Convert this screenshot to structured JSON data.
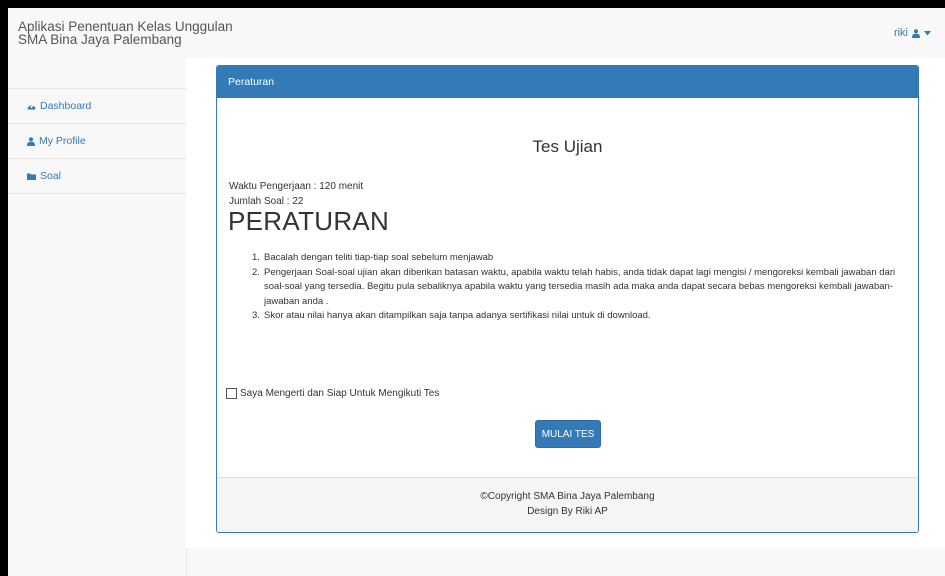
{
  "navbar": {
    "brand_line1": "Aplikasi Penentuan Kelas Unggulan",
    "brand_line2": "SMA Bina Jaya Palembang",
    "user_name": "riki",
    "user_icon": "user-icon",
    "caret_icon": "caret-down-icon"
  },
  "sidebar": {
    "items": [
      {
        "label": "Dashboard",
        "icon": "dashboard-icon"
      },
      {
        "label": "My Profile",
        "icon": "user-icon"
      },
      {
        "label": "Soal",
        "icon": "folder-icon"
      }
    ]
  },
  "panel": {
    "heading": "Peraturan",
    "test_title": "Tes Ujian",
    "duration": "Waktu Pengerjaan : 120 menit",
    "question_count": "Jumlah Soal : 22",
    "rules_title": "PERATURAN",
    "rules": [
      {
        "num": "1.",
        "text": "Bacalah dengan teliti tiap-tiap soal sebelum menjawab"
      },
      {
        "num": "2.",
        "text": "Pengerjaan Soal-soal ujian akan diberikan batasan waktu, apabila waktu telah habis, anda tidak dapat lagi mengisi / mengoreksi kembali jawaban dari soal-soal yang tersedia. Begitu pula sebaliknya apabila waktu yang tersedia masih ada maka anda dapat secara bebas mengoreksi kembali jawaban-jawaban anda ."
      },
      {
        "num": "3.",
        "text": "Skor atau nilai hanya akan ditampilkan saja tanpa adanya sertifikasi nilai untuk di download."
      }
    ],
    "agree_label": "Saya Mengerti dan Siap Untuk Mengikuti Tes",
    "agree_checked": false,
    "start_button": "MULAI TES",
    "footer_line1": "©Copyright SMA Bina Jaya Palembang",
    "footer_line2": "Design By Riki AP"
  },
  "colors": {
    "primary": "#337ab7",
    "navbar_bg": "#f8f8f8",
    "footer_bg": "#f5f5f5"
  }
}
